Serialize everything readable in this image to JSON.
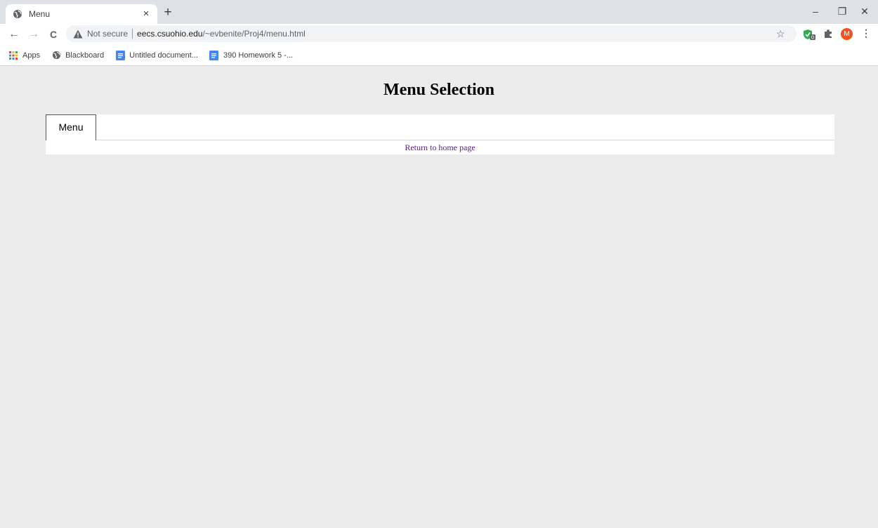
{
  "browser": {
    "tab": {
      "title": "Menu",
      "close": "×"
    },
    "new_tab": "+",
    "window_controls": {
      "minimize": "–",
      "restore": "❐",
      "close": "✕"
    },
    "nav": {
      "back": "←",
      "forward": "→",
      "reload": "C"
    },
    "omnibox": {
      "security_label": "Not secure",
      "host": "eecs.csuohio.edu",
      "path": "/~evbenite/Proj4/menu.html"
    },
    "star": "☆",
    "avatar_letter": "M",
    "menu": "⋮",
    "bookmarks": [
      {
        "label": "Apps",
        "icon": "apps-grid-icon"
      },
      {
        "label": "Blackboard",
        "icon": "globe-icon"
      },
      {
        "label": "Untitled document...",
        "icon": "docs-icon"
      },
      {
        "label": "390 Homework 5 -...",
        "icon": "docs-icon"
      }
    ],
    "colors": {
      "tabstrip": "#dee1e6",
      "avatar": "#f4511e",
      "docs": "#4285f4",
      "shield": "#34a853"
    }
  },
  "page": {
    "title": "Menu Selection",
    "menu_tab": "Menu",
    "home_link": "Return to home page",
    "colors": {
      "background": "#ececec",
      "link_visited": "#551a8b"
    }
  }
}
